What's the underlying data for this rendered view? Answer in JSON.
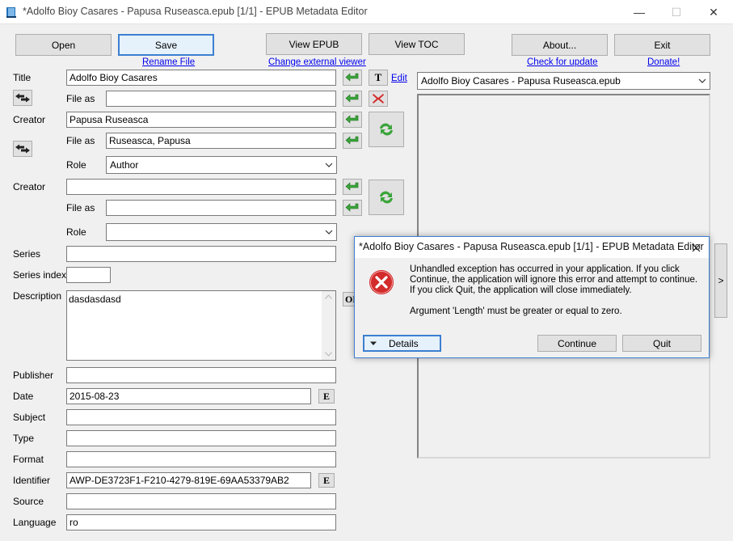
{
  "window": {
    "title": "*Adolfo Bioy Casares - Papusa Ruseasca.epub [1/1] - EPUB Metadata Editor",
    "minimize": "—",
    "maximize": "☐",
    "close": "✕"
  },
  "toolbar": {
    "open_label": "Open",
    "save_label": "Save",
    "view_epub_label": "View EPUB",
    "view_toc_label": "View TOC",
    "about_label": "About...",
    "exit_label": "Exit",
    "rename_file_link": "Rename File",
    "change_viewer_link": "Change external viewer",
    "check_update_link": "Check for update",
    "donate_link": "Donate!"
  },
  "form": {
    "title_label": "Title",
    "title_value": "Adolfo Bioy Casares",
    "file_as_label": "File as",
    "title_file_as_value": "",
    "edit_link": "Edit",
    "t_button": "T",
    "creator1_label": "Creator",
    "creator1_value": "Papusa Ruseasca",
    "creator1_file_as_value": "Ruseasca, Papusa",
    "role_label": "Role",
    "creator1_role_value": "Author",
    "creator2_label": "Creator",
    "creator2_value": "",
    "creator2_file_as_value": "",
    "creator2_role_value": "",
    "series_label": "Series",
    "series_value": "",
    "series_index_label": "Series index",
    "series_index_value": "",
    "description_label": "Description",
    "description_value": "dasdasdasd",
    "publisher_label": "Publisher",
    "publisher_value": "",
    "date_label": "Date",
    "date_value": "2015-08-23",
    "e_button": "E",
    "subject_label": "Subject",
    "subject_value": "",
    "type_label": "Type",
    "type_value": "",
    "format_label": "Format",
    "format_value": "",
    "identifier_label": "Identifier",
    "identifier_value": "AWP-DE3723F1-F210-4279-819E-69AA53379AB2",
    "source_label": "Source",
    "source_value": "",
    "language_label": "Language",
    "language_value": "ro",
    "ok_partial": "OK"
  },
  "right_panel": {
    "file_select_value": "Adolfo Bioy Casares - Papusa Ruseasca.epub",
    "next_arrow": ">"
  },
  "dialog": {
    "title": "*Adolfo Bioy Casares - Papusa Ruseasca.epub [1/1] - EPUB Metadata Editor",
    "message": "Unhandled exception has occurred in your application. If you click Continue, the application will ignore this error and attempt to continue. If you click Quit, the application will close immediately.",
    "detail": "Argument 'Length' must be greater or equal to zero.",
    "details_label": "Details",
    "continue_label": "Continue",
    "quit_label": "Quit"
  },
  "icons": {
    "app": "book-icon",
    "copy_left": "green-arrow-left-icon",
    "swap": "swap-arrows-icon",
    "delete": "red-x-icon",
    "refresh": "green-refresh-icon",
    "error": "error-icon"
  },
  "colors": {
    "accent": "#3c7fd1",
    "link": "#0000ee",
    "error_red": "#d32b2b",
    "green": "#3aa53a"
  }
}
